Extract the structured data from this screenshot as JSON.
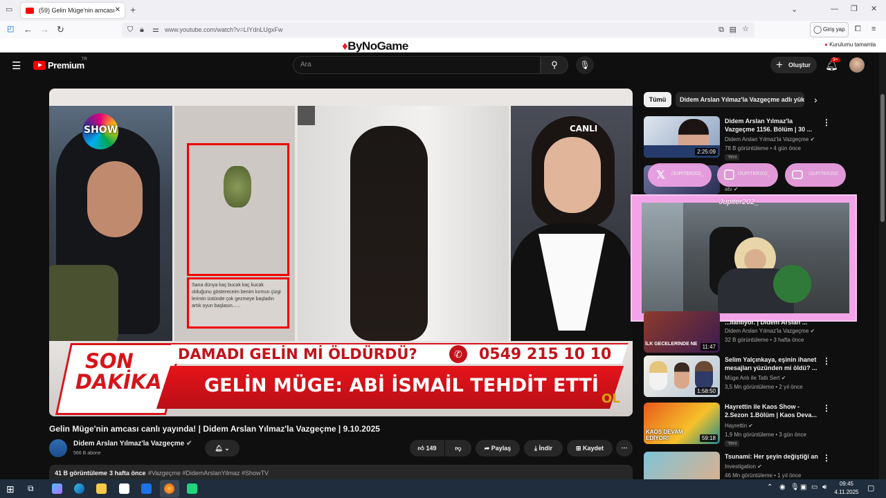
{
  "browser": {
    "tab_title": "(59) Gelin Müge'nin amcası",
    "new_tab_symbol": "+",
    "url": "www.youtube.com/watch?v=LIYdnLUgxFw",
    "signin_label": "Giriş yap",
    "bookmark_label": "Kurulumu tamamla"
  },
  "overlay": {
    "bynogame_logo": "ByNoGame"
  },
  "youtube": {
    "logo": "Premium",
    "logo_sup": "TR",
    "search_placeholder": "Ara",
    "create_label": "Oluştur",
    "notif_count": "9+",
    "chips": [
      "Tümü",
      "Didem Arslan Yılmaz'la Vazgeçme adlı yük"
    ]
  },
  "video": {
    "channel_logo": "SHOW",
    "live_label": "CANLI",
    "banner_left_1": "SON",
    "banner_left_2": "DAKİKA",
    "banner_top": "DAMADI GELİN Mİ ÖLDÜRDÜ?",
    "banner_phone": "0549 215 10 10",
    "banner_bottom": "GELİN MÜGE: ABİ İSMAİL TEHDİT ETTİ",
    "corner_tag": "OL",
    "evidence_caption": "Sana dünya kaç bucak kaç kucak olduğunu göstereceim benim kırmızı çizgi lerimin üstünde çok gezmeye başladın artık oyun başlasın......"
  },
  "meta": {
    "title": "Gelin Müge'nin amcası canlı yayında! | Didem Arslan Yılmaz'la Vazgeçme | 9.10.2025",
    "channel": "Didem Arslan Yılmaz'la Vazgeçme",
    "subs": "566 B abone",
    "likes": "149",
    "share": "Paylaş",
    "download": "İndir",
    "save": "Kaydet",
    "views": "41 B görüntüleme",
    "when": "3 hafta önce",
    "tags": "#Vazgeçme #DidemArslanYilmaz #ShowTV"
  },
  "recs": [
    {
      "title": "Didem Arslan Yılmaz'la Vazgeçme 1156. Bölüm | 30 ...",
      "channel": "Didem Arslan Yılmaz'la Vazgeçme",
      "stats": "78 B görüntüleme • 4 gün önce",
      "badge": "Yeni",
      "dur": "2:25:09"
    },
    {
      "title": "...ilanlıyor. | Didem Arslan ...",
      "channel": "Didem Arslan Yılmaz'la Vazgeçme",
      "stats": "32 B görüntüleme • 3 hafta önce",
      "badge": "",
      "dur": "11:47",
      "thumb_text": "İLK GECELERİNDE NE"
    },
    {
      "title": "Selim Yalçınkaya, eşinin ihanet mesajları yüzünden mi öldü? ...",
      "channel": "Müge Anlı ile Tatlı Sert",
      "stats": "3,5 Mn görüntüleme • 2 yıl önce",
      "badge": "",
      "dur": "1:58:50"
    },
    {
      "title": "Hayrettin ile Kaos Show - 2.Sezon 1.Bölüm | Kaos Deva...",
      "channel": "Hayrettin",
      "stats": "1,9 Mn görüntüleme • 3 gün önce",
      "badge": "Yeni",
      "dur": "59:18",
      "thumb_text": "KAOS DEVAM EDİYOR!"
    },
    {
      "title": "Tsunami: Her şeyin değiştiği an",
      "channel": "Investigation",
      "stats": "46 Mn görüntüleme • 1 yıl önce",
      "badge": "",
      "dur": ""
    }
  ],
  "rec2_partial": {
    "channel_short": "atv"
  },
  "streamer": {
    "handle": "Jupiter202_",
    "socials": [
      "/JUPITER202_",
      "/JUPITER202_",
      "/JUPITER202"
    ]
  },
  "taskbar": {
    "time": "09:45",
    "date": "4.11.2025"
  },
  "colors": {
    "yt_red": "#ff0000",
    "banner_red": "#d7141a",
    "overlay_pink": "#f3a4e8"
  }
}
